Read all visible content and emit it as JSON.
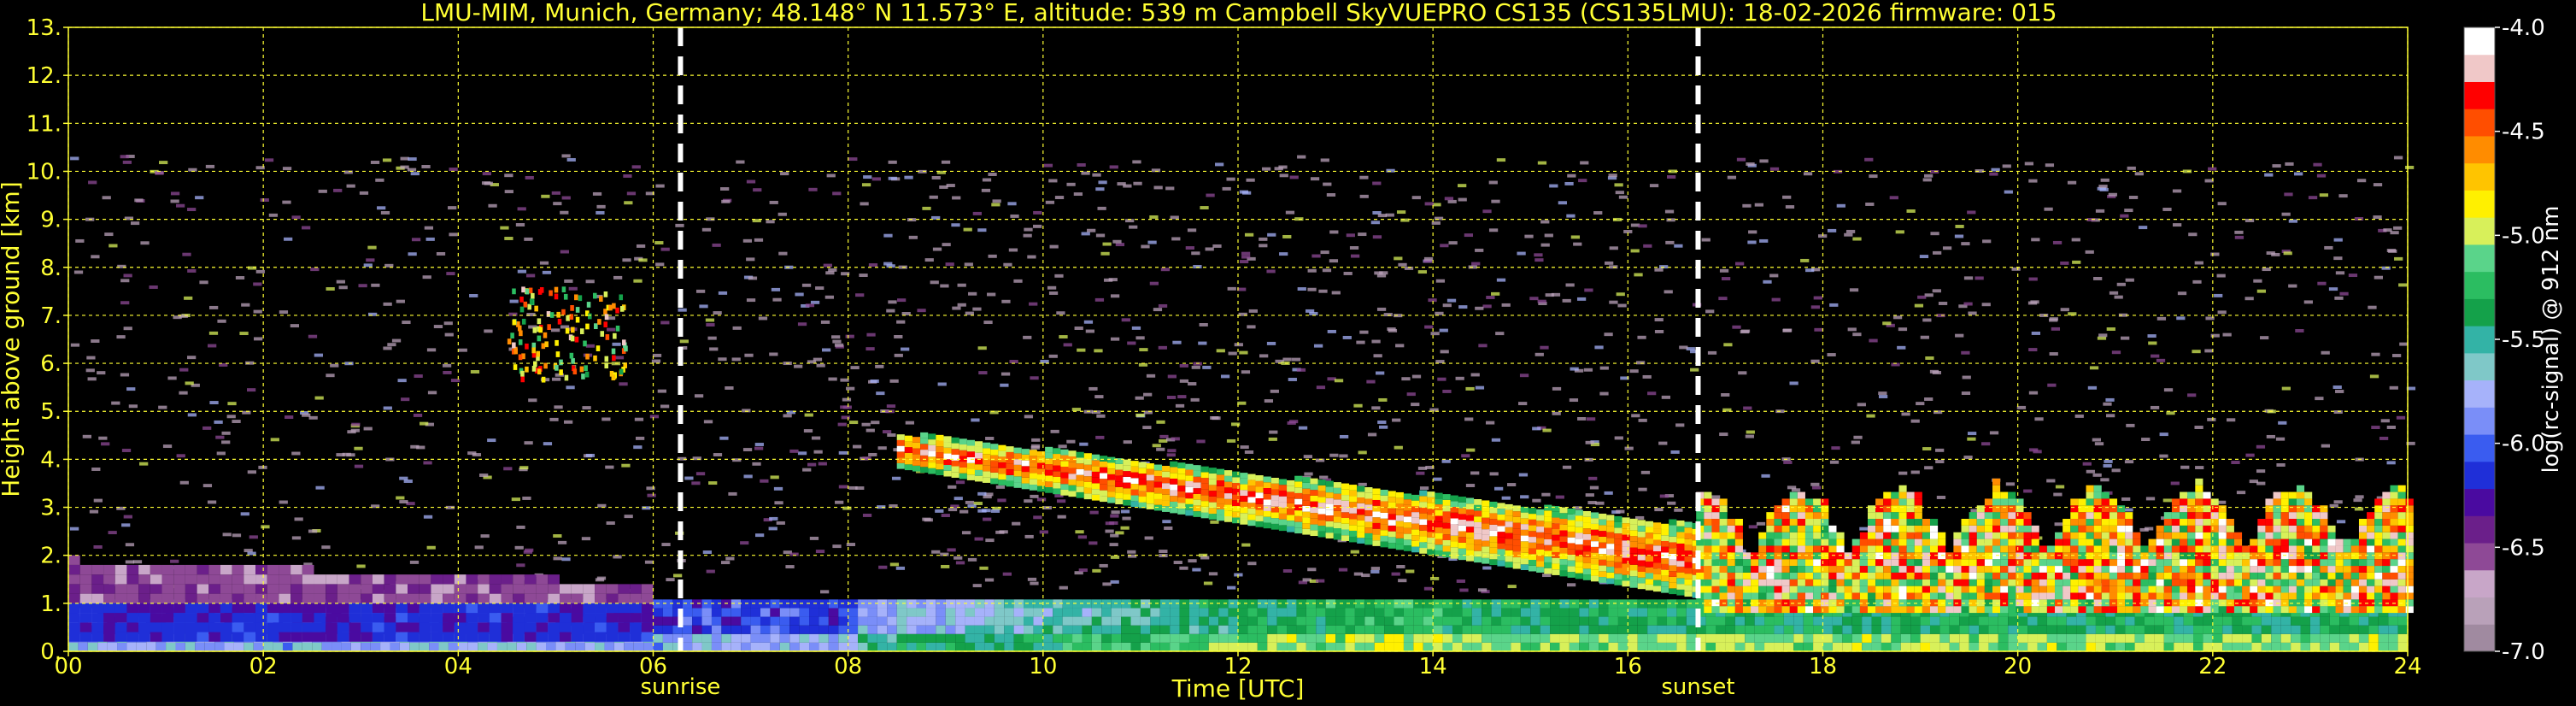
{
  "chart_data": {
    "type": "heatmap",
    "title": "LMU-MIM, Munich, Germany; 48.148° N 11.573° E, altitude: 539 m    Campbell SkyVUEPRO CS135 (CS135LMU): 18-02-2026    firmware: 015",
    "xlabel": "Time [UTC]",
    "ylabel": "Height above ground [km]",
    "colorbar_label": "log(rc-signal) @ 912 nm",
    "xlim": [
      0,
      24
    ],
    "ylim": [
      0,
      13
    ],
    "clim": [
      -7.0,
      -4.0
    ],
    "x_ticks": [
      "00",
      "02",
      "04",
      "06",
      "08",
      "10",
      "12",
      "14",
      "16",
      "18",
      "20",
      "22",
      "24"
    ],
    "y_ticks": [
      "0.",
      "1.",
      "2.",
      "3.",
      "4.",
      "5.",
      "6.",
      "7.",
      "8.",
      "9.",
      "10.",
      "11.",
      "12.",
      "13."
    ],
    "colorbar_ticks": [
      "-4.0",
      "-4.5",
      "-5.0",
      "-5.5",
      "-6.0",
      "-6.5",
      "-7.0"
    ],
    "grid": true,
    "events": [
      {
        "label": "sunrise",
        "time": 6.28
      },
      {
        "label": "sunset",
        "time": 16.72
      }
    ],
    "layers": [
      {
        "desc": "noise",
        "t0": 0,
        "t1": 24,
        "h0": 0.3,
        "h1": 10.3
      },
      {
        "desc": "boundary layer aerosol",
        "t0": 0,
        "t1": 24,
        "h0": 0.0,
        "h1": 1.0
      },
      {
        "desc": "morning aerosol layer",
        "t0": 0,
        "t1": 6,
        "h0": 0.2,
        "h1": 1.8
      },
      {
        "desc": "mid-level cloud",
        "t0": 4.5,
        "t1": 5.7,
        "h0": 5.6,
        "h1": 7.5
      },
      {
        "desc": "descending cloud",
        "t0": 8.5,
        "t1": 17.0,
        "h0_start": 3.8,
        "h1_start": 4.5,
        "h0_end": 1.0,
        "h1_end": 2.5
      },
      {
        "desc": "evening low cloud",
        "t0": 16.7,
        "t1": 24,
        "h0": 0.2,
        "h1": 3.5
      }
    ],
    "colormap": [
      "#a08aa0",
      "#b9a1b9",
      "#c8a6c8",
      "#8e4996",
      "#6b1f8a",
      "#4a0aa0",
      "#1f2fd8",
      "#3a5cf0",
      "#7a8ef8",
      "#a6b2fa",
      "#7fc8c8",
      "#33b3a6",
      "#14a14a",
      "#2bbd61",
      "#5ad48a",
      "#d8f05a",
      "#fff000",
      "#ffc400",
      "#ff8c00",
      "#ff4e00",
      "#ff0000",
      "#f0c8c8",
      "#ffffff"
    ]
  }
}
